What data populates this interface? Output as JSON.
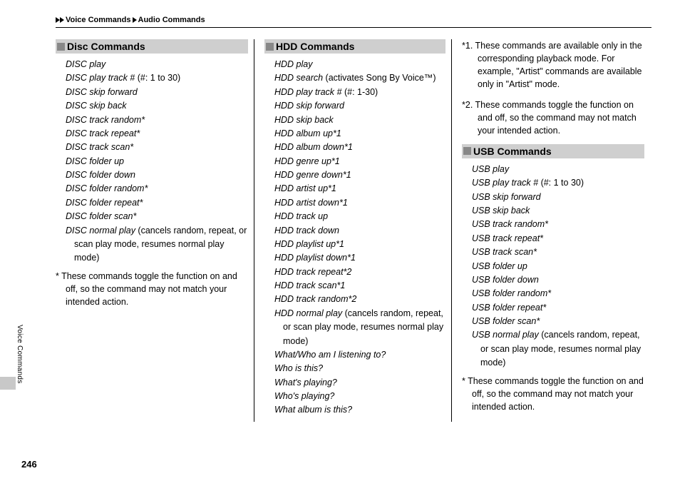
{
  "breadcrumb": {
    "a": "Voice Commands",
    "b": "Audio Commands"
  },
  "side_label": "Voice Commands",
  "page_number": "246",
  "disc": {
    "heading": "Disc Commands",
    "items": [
      {
        "t": "DISC play"
      },
      {
        "t": "DISC play track #",
        "p": " (#: 1 to 30)"
      },
      {
        "t": "DISC skip forward"
      },
      {
        "t": "DISC skip back"
      },
      {
        "t": "DISC track random*"
      },
      {
        "t": "DISC track repeat*"
      },
      {
        "t": "DISC track scan*"
      },
      {
        "t": "DISC folder up"
      },
      {
        "t": "DISC folder down"
      },
      {
        "t": "DISC folder random*"
      },
      {
        "t": "DISC folder repeat*"
      },
      {
        "t": "DISC folder scan*"
      },
      {
        "t": "DISC normal play",
        "p": " (cancels random, repeat, or scan play mode, resumes normal play mode)"
      }
    ],
    "footnote": "*  These commands toggle the function on and off, so the command may not match your intended action."
  },
  "hdd": {
    "heading": "HDD Commands",
    "items": [
      {
        "t": "HDD play"
      },
      {
        "t": "HDD search",
        "p": " (activates Song By Voice™)"
      },
      {
        "t": "HDD play track #",
        "p": " (#: 1-30)"
      },
      {
        "t": "HDD skip forward"
      },
      {
        "t": "HDD skip back"
      },
      {
        "t": "HDD album up*1"
      },
      {
        "t": "HDD album down*1"
      },
      {
        "t": "HDD genre up*1"
      },
      {
        "t": "HDD genre down*1"
      },
      {
        "t": "HDD artist up*1"
      },
      {
        "t": "HDD artist down*1"
      },
      {
        "t": "HDD track up"
      },
      {
        "t": "HDD track down"
      },
      {
        "t": "HDD playlist up*1"
      },
      {
        "t": "HDD playlist down*1"
      },
      {
        "t": "HDD track repeat*2"
      },
      {
        "t": "HDD track scan*1"
      },
      {
        "t": "HDD track random*2"
      },
      {
        "t": "HDD normal play",
        "p": " (cancels random, repeat, or scan play mode, resumes normal play mode)"
      },
      {
        "t": "What/Who am I listening to?"
      },
      {
        "t": "Who is this?"
      },
      {
        "t": "What's playing?"
      },
      {
        "t": "Who's playing?"
      },
      {
        "t": "What album is this?"
      }
    ]
  },
  "notes": {
    "n1": "*1. These commands are available only in the corresponding playback mode. For example, \"Artist\" commands are available only in \"Artist\" mode.",
    "n2": "*2. These commands toggle the function on and off, so the command may not match your intended action."
  },
  "usb": {
    "heading": "USB Commands",
    "items": [
      {
        "t": "USB play"
      },
      {
        "t": "USB play track #",
        "p": " (#: 1 to 30)"
      },
      {
        "t": "USB skip forward"
      },
      {
        "t": "USB skip back"
      },
      {
        "t": "USB track random*"
      },
      {
        "t": "USB track repeat*"
      },
      {
        "t": "USB track scan*"
      },
      {
        "t": "USB folder up"
      },
      {
        "t": "USB folder down"
      },
      {
        "t": "USB folder random*"
      },
      {
        "t": "USB folder repeat*"
      },
      {
        "t": "USB folder scan*"
      },
      {
        "t": "USB normal play",
        "p": " (cancels random, repeat, or scan play mode, resumes normal play mode)"
      }
    ],
    "footnote": "*  These commands toggle the function on and off, so the command may not match your intended action."
  }
}
